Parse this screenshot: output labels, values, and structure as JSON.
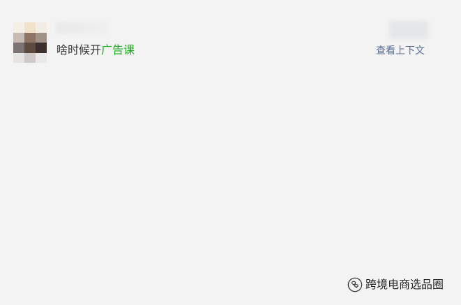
{
  "comment": {
    "text_prefix": "啥时候开",
    "text_highlight": "广告课",
    "context_link_label": "查看上下文"
  },
  "watermark": {
    "text": "跨境电商选品圈",
    "icon": "wechat-official-account-icon"
  },
  "colors": {
    "background": "#f3f3f3",
    "text": "#333333",
    "highlight": "#1aad19",
    "link": "#576b95",
    "avatar_pixels": [
      "#f4efe6",
      "#efe3cc",
      "#f1ede6",
      "#c6bcb3",
      "#8e7464",
      "#a19288",
      "#7c7472",
      "#5b4a3d",
      "#3b302d",
      "#e6e4e3",
      "#cfcac8",
      "#e9e8e8"
    ]
  }
}
